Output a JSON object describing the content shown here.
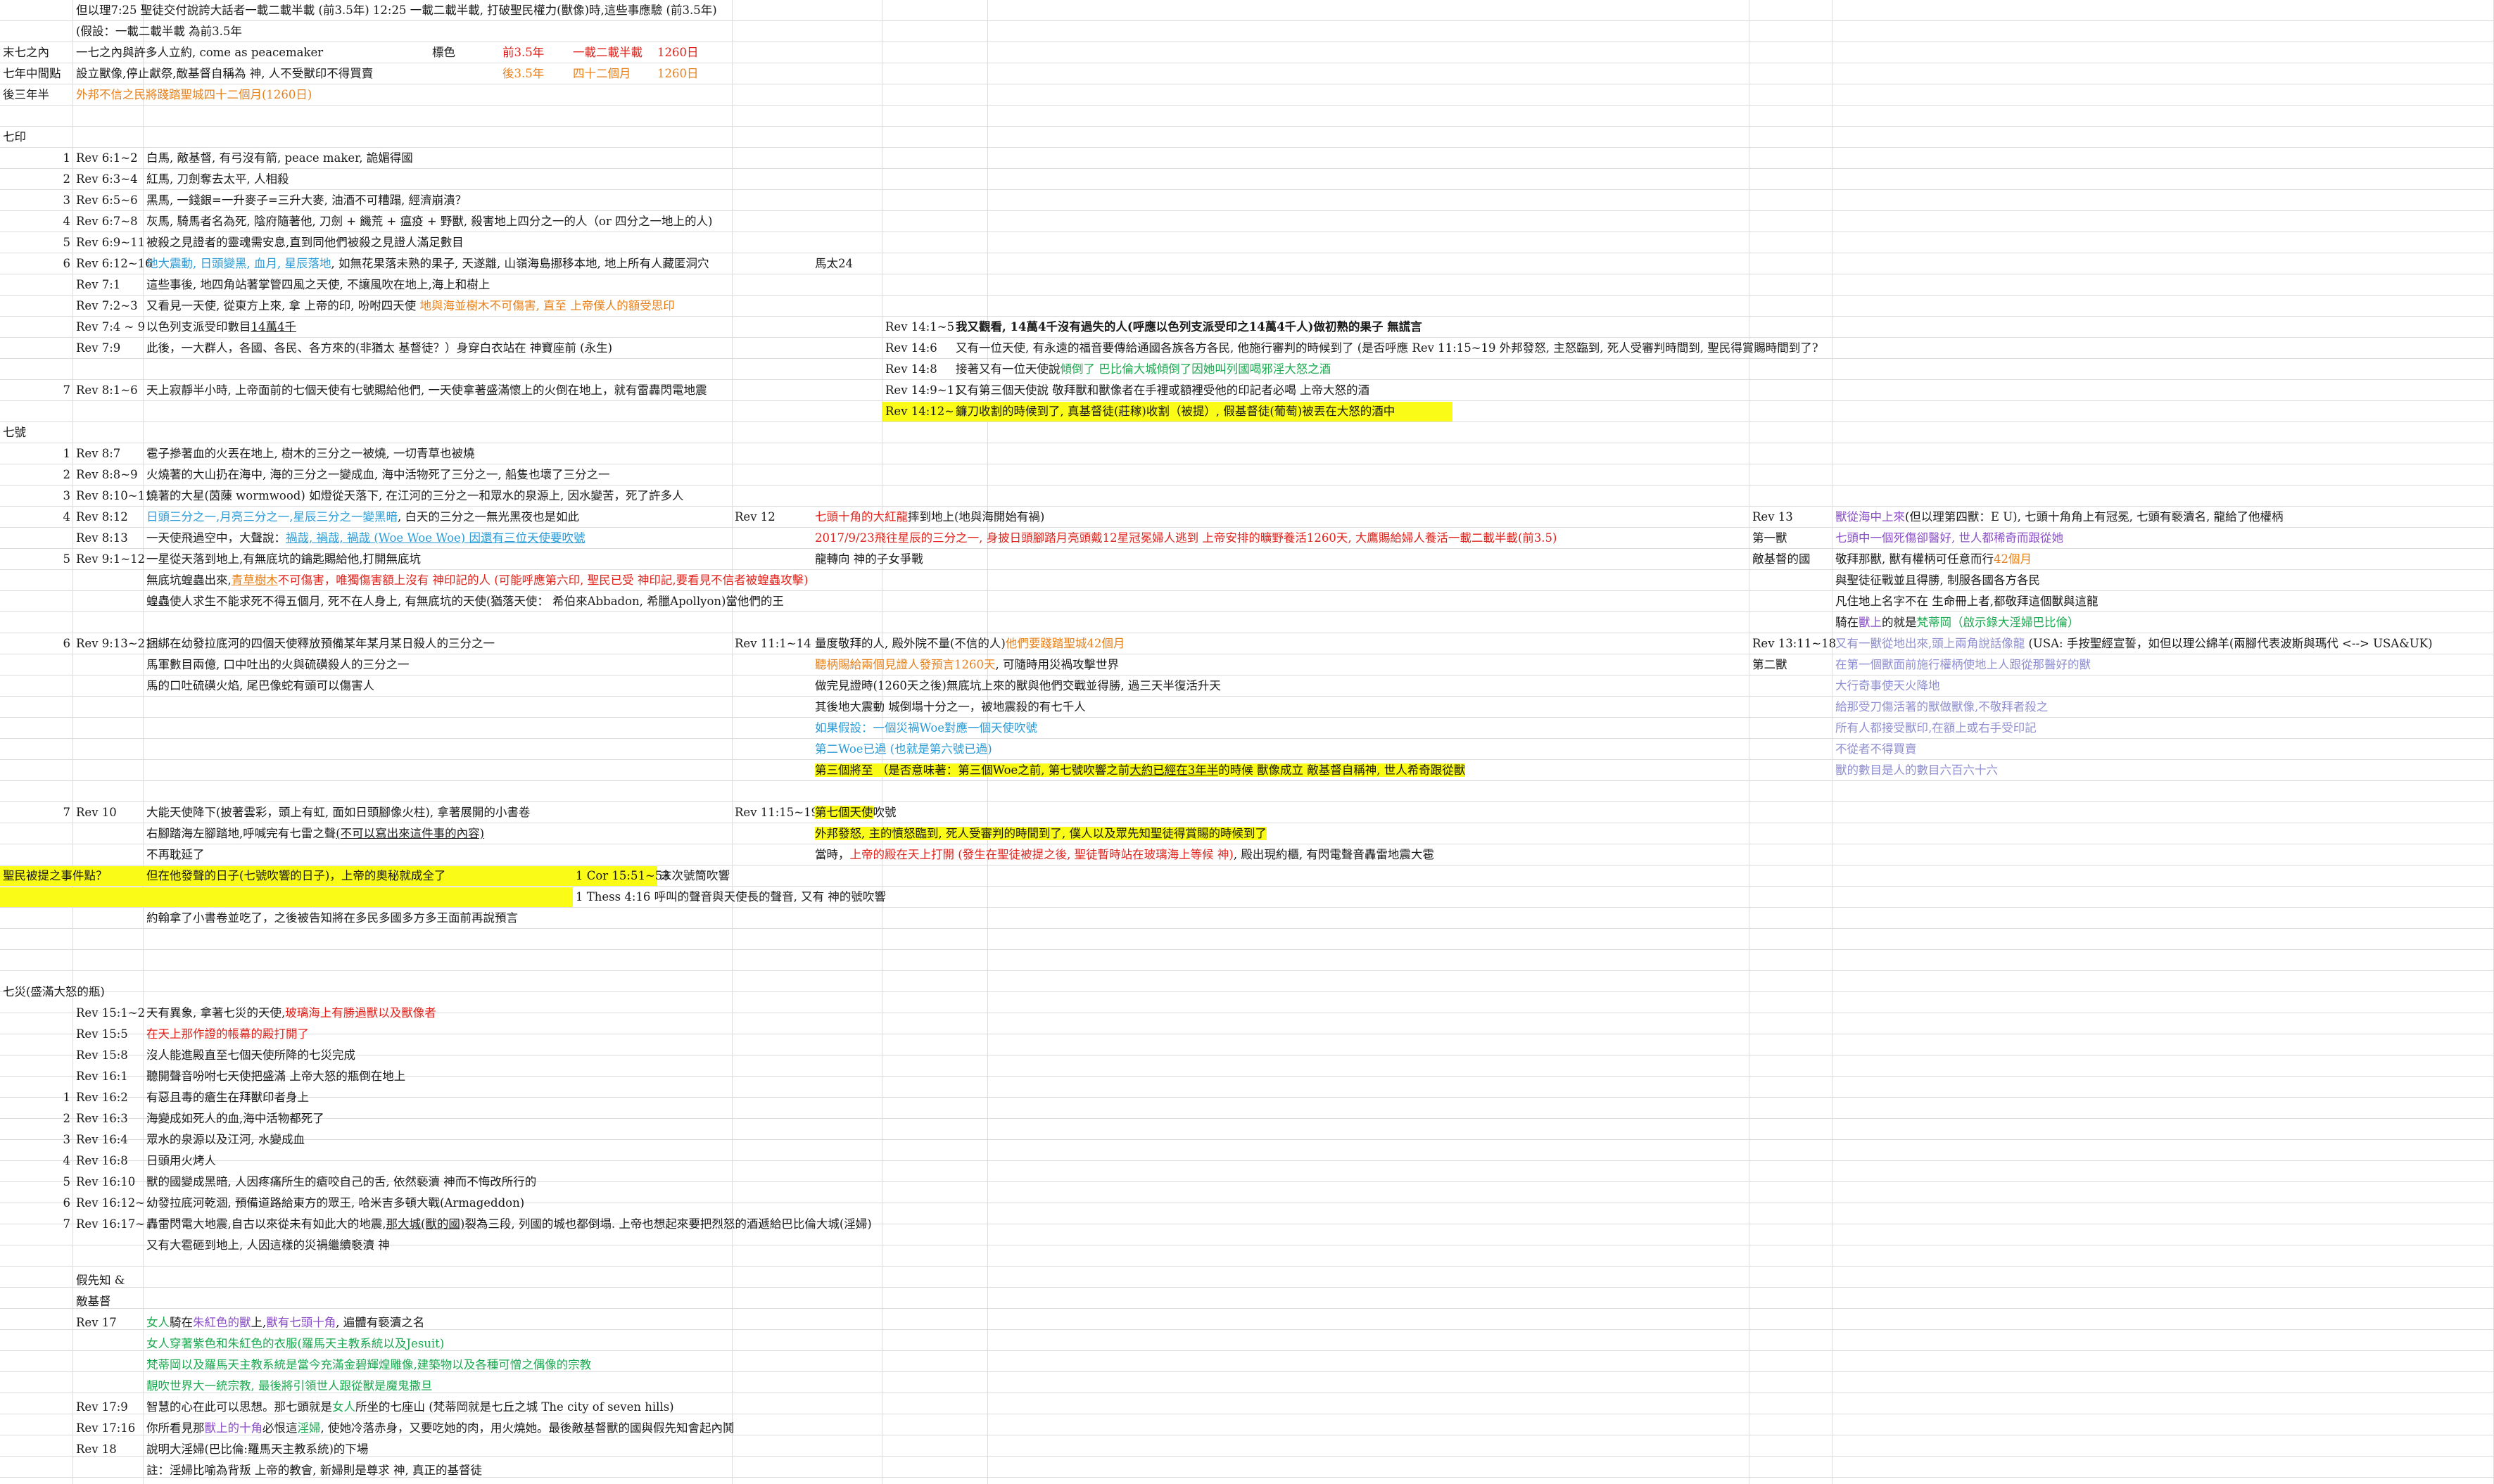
{
  "header": {
    "r0": "但以理7:25 聖徒交付說誇大話者一載二載半載 (前3.5年) 12:25 一載二載半載, 打破聖民權力(獸像)時,這些事應驗 (前3.5年)",
    "r1": "(假設：一載二載半載 為前3.5年",
    "r2a": "末七之內",
    "r2b": "一七之內與許多人立約, come as peacemaker",
    "r2c": "標色",
    "r2d": "前3.5年",
    "r2e": "一載二載半載",
    "r2f": "1260日",
    "r3a": "七年中間點",
    "r3b": "設立獸像,停止獻祭,敵基督自稱為 神, 人不受獸印不得買賣",
    "r3c": "後3.5年",
    "r3d": "四十二個月",
    "r3e": "1260日",
    "r4a": "後三年半",
    "r4b": "外邦不信之民將踐踏聖城四十二個月(1260日)"
  },
  "seals": {
    "title": "七印",
    "rows": [
      {
        "n": "1",
        "ref": "Rev 6:1~2",
        "text": "白馬, 敵基督, 有弓沒有箭, peace maker, 詭媚得國"
      },
      {
        "n": "2",
        "ref": "Rev 6:3~4",
        "text": "紅馬, 刀劍奪去太平, 人相殺"
      },
      {
        "n": "3",
        "ref": "Rev 6:5~6",
        "text": "黑馬, 一錢銀=一升麥子=三升大麥, 油酒不可糟蹋, 經濟崩潰？"
      },
      {
        "n": "4",
        "ref": "Rev 6:7~8",
        "text": "灰馬, 騎馬者名為死, 陰府隨著他, 刀劍 + 饑荒 + 瘟疫 + 野獸, 殺害地上四分之一的人（or 四分之一地上的人)"
      },
      {
        "n": "5",
        "ref": "Rev 6:9~11",
        "text": "被殺之見證者的靈魂需安息,直到同他們被殺之見證人滿足數目"
      },
      {
        "n": "6",
        "ref": "Rev 6:12~16",
        "textBlue": "地大震動, 日頭變黑, 血月, 星辰落地",
        "text": ", 如無花果落未熟的果子, 天遂離, 山嶺海島挪移本地, 地上所有人藏匿洞穴",
        "side": "馬太24"
      },
      {
        "n": "",
        "ref": "Rev 7:1",
        "text": "這些事後, 地四角站著掌管四風之天使, 不讓風吹在地上,海上和樹上"
      },
      {
        "n": "",
        "ref": "Rev 7:2~3",
        "text": "又看見一天使, 從東方上來, 拿 上帝的印, 吩咐四天使 ",
        "textOrange": "地與海並樹木不可傷害, 直至 上帝僕人的額受思印"
      },
      {
        "n": "",
        "ref": "Rev 7:4 ~ 9",
        "text": "以色列支派受印數目",
        "textU": "14萬4千"
      },
      {
        "n": "",
        "ref": "Rev 7:9",
        "text": "此後，一大群人，各國、各民、各方來的(非猶太 基督徒？）身穿白衣站在 神寶座前 (永生)"
      },
      {
        "n": "7",
        "ref": "Rev 8:1~6",
        "text": "天上寂靜半小時, 上帝面前的七個天使有七號賜給他們, 一天使拿著盛滿懷上的火倒在地上，就有雷轟閃電地震"
      }
    ],
    "right": [
      {
        "ref": "Rev 14:1~5",
        "text": "我又觀看, 14萬4千沒有過失的人(呼應以色列支派受印之14萬4千人)做初熟的果子 無謊言"
      },
      {
        "ref": "Rev 14:6",
        "text": "又有一位天使, 有永遠的福音要傳給通國各族各方各民, 他施行審判的時候到了 (是否呼應 Rev 11:15~19 外邦發怒, 主怒臨到, 死人受審判時間到, 聖民得賞賜時間到了?"
      },
      {
        "ref": "Rev 14:8",
        "text": "接著又有一位天使說",
        "textGreen": "傾倒了 巴比倫大城傾倒了因她叫列國喝邪淫大怒之酒"
      },
      {
        "ref": "Rev 14:9~11",
        "text": "又有第三個天使說 敬拜獸和獸像者在手裡或額裡受他的印記者必喝 上帝大怒的酒"
      },
      {
        "ref": "Rev 14:12~1",
        "text": "鐮刀收割的時候到了, 真基督徒(莊稼)收割（被提）, 假基督徒(葡萄)被丟在大怒的酒中"
      }
    ]
  },
  "trumpets": {
    "title": "七號",
    "rows": [
      {
        "n": "1",
        "ref": "Rev 8:7",
        "text": "雹子摻著血的火丟在地上, 樹木的三分之一被燒, 一切青草也被燒"
      },
      {
        "n": "2",
        "ref": "Rev 8:8~9",
        "text": "火燒著的大山扔在海中, 海的三分之一變成血, 海中活物死了三分之一, 船隻也壞了三分之一"
      },
      {
        "n": "3",
        "ref": "Rev 8:10~11",
        "text": "燒著的大星(茵蔯 wormwood) 如燈從天落下, 在江河的三分之一和眾水的泉源上, 因水變苦，死了許多人"
      },
      {
        "n": "4",
        "ref": "Rev 8:12",
        "textBlue": "日頭三分之一,月亮三分之一,星辰三分之一變黑暗",
        "text": ", 白天的三分之一無光黑夜也是如此"
      },
      {
        "n": "",
        "ref": "Rev 8:13",
        "text": "一天使飛過空中，大聲說：",
        "textBlueU": "禍哉, 禍哉, 禍哉 (Woe Woe Woe) 因還有三位天使要吹號"
      },
      {
        "n": "5",
        "ref": "Rev 9:1~12",
        "text": "一星從天落到地上,有無底坑的鑰匙賜給他,打開無底坑"
      },
      {
        "n": "",
        "ref": "",
        "text": "無底坑蝗蟲出來,",
        "textOrangeU": "青草樹木",
        "textRed": "不可傷害，唯獨傷害額上沒有 神印記的人 (可能呼應第六印, 聖民已受 神印記,要看見不信者被蝗蟲攻擊)"
      },
      {
        "n": "",
        "ref": "",
        "text": "蝗蟲使人求生不能求死不得五個月, 死不在人身上, 有無底坑的天使(猶落天使： 希伯來Abbadon, 希臘Apollyon)當他們的王"
      },
      {
        "n": "6",
        "ref": "Rev 9:13~21",
        "text": "捆綁在幼發拉底河的四個天使釋放預備某年某月某日殺人的三分之一"
      },
      {
        "n": "",
        "ref": "",
        "text": "馬軍數目兩億, 口中吐出的火與硫磺殺人的三分之一"
      },
      {
        "n": "",
        "ref": "",
        "text": "馬的口吐硫磺火焰, 尾巴像蛇有頭可以傷害人"
      },
      {
        "n": "7",
        "ref": "Rev 10",
        "text": "大能天使降下(披著雲彩，頭上有虹, 面如日頭腳像火柱), 拿著展開的小書卷"
      },
      {
        "n": "",
        "ref": "",
        "text": "右腳踏海左腳踏地,呼喊完有七雷之聲",
        "textU": "(不可以寫出來這件事的內容)"
      },
      {
        "n": "",
        "ref": "",
        "text": "不再耽延了"
      }
    ],
    "mid": [
      {
        "ref": "Rev 12",
        "textRed": "七頭十角的大紅龍",
        "text": "摔到地上(地與海開始有禍)"
      },
      {
        "ref": "",
        "textRed": "2017/9/23飛往星辰的三分之一, 身披日頭腳踏月亮頭戴12星冠冕婦人逃到 上帝安排的曠野養活1260天, 大鷹賜給婦人養活一載二載半載(前3.5)"
      },
      {
        "ref": "",
        "text": "龍轉向 神的子女爭戰"
      },
      {
        "ref": "Rev 11:1~14",
        "text": "量度敬拜的人, 殿外院不量(不信的人)",
        "textOrange": "他們要踐踏聖城42個月"
      },
      {
        "ref": "",
        "textOrange": "聽柄賜給兩個見證人發預言1260天",
        "text": ", 可隨時用災禍攻擊世界"
      },
      {
        "ref": "",
        "text": "做完見證時(1260天之後)無底坑上來的獸與他們交戰並得勝, 過三天半復活升天"
      },
      {
        "ref": "",
        "text": "其後地大震動 城倒塌十分之一，被地震殺的有七千人"
      },
      {
        "ref": "",
        "textBlue": "如果假設：一個災禍Woe對應一個天使吹號"
      },
      {
        "ref": "",
        "textBlue": "第二Woe已過 (也就是第六號已過)"
      },
      {
        "ref": "",
        "textHl": "第三個將至 （是否意味著：第三個Woe之前, 第七號吹響之前",
        "textHlU": "大約已經在3年半",
        "textHl2": "的時候 獸像成立 敵基督自稱神, 世人希奇跟從獸"
      },
      {
        "ref": "Rev 11:15~19",
        "textHl": "第七個天使",
        "text": "吹號"
      },
      {
        "ref": "",
        "textHl": "外邦發怒, 主的憤怒臨到, 死人受審判的時間到了, 僕人以及眾先知聖徒得賞賜的時候到了"
      },
      {
        "ref": "",
        "text": "當時，",
        "textRed": "上帝的殿在天上打開 (發生在聖徒被提之後, 聖徒暫時站在玻璃海上等候 神)",
        "text2": ", 殿出現約櫃, 有閃電聲音轟雷地震大雹"
      }
    ],
    "right": [
      {
        "ref": "Rev 13",
        "textPurple": "獸從海中上來",
        "textPurple2": "(但以理第四獸：E U), 七頭十角",
        "text": "角上有冠冕, 七頭有褻瀆名, 龍給了他權柄"
      },
      {
        "ref": "第一獸",
        "textPurple": "七頭中一個死傷卻醫好, 世人都稀奇而跟從她"
      },
      {
        "ref": "敵基督的國",
        "text": "敬拜那獸, 獸有權柄可任意而行",
        "textOrange": "42個月"
      },
      {
        "ref": "",
        "text": "與聖徒征戰並且得勝, 制服各國各方各民"
      },
      {
        "ref": "",
        "text": "凡住地上名字不在 生命冊上者,都敬拜這個獸與這龍"
      },
      {
        "ref": "",
        "text": "騎在",
        "textPurple": "獸上",
        "text2": "的就是",
        "textGreen": "梵蒂岡（啟示錄大淫婦巴比倫）"
      },
      {
        "ref": "Rev 13:11~18",
        "textLav": "又有一獸從地出來,頭上兩角說話像龍",
        "text": " (USA: 手按聖經宣誓，如但以理公綿羊(兩腳代表波斯與瑪代 <--> USA&UK)"
      },
      {
        "ref": "第二獸",
        "textLav": "在第一個獸面前施行權柄使地上人跟從那醫好的獸"
      },
      {
        "ref": "",
        "textLav": "大行奇事使天火降地"
      },
      {
        "ref": "",
        "textLav": "給那受刀傷活著的獸做獸像,不敬拜者殺之"
      },
      {
        "ref": "",
        "textLav": "所有人都接受獸印,在額上或右手受印記"
      },
      {
        "ref": "",
        "textLav": "不從者不得買賣"
      },
      {
        "ref": "",
        "textLav": "獸的數目是人的數目六百六十六"
      }
    ],
    "rapture": {
      "label": "聖民被提之事件點？",
      "text": "但在他發聲的日子(七號吹響的日子)，上帝的奧秘就成全了",
      "cor": "1 Cor 15:51~53",
      "corText": "末次號筒吹響",
      "thes": "1 Thess 4:16 呼叫的聲音與天使長的聲音, 又有 神的號吹響"
    },
    "after": "約翰拿了小書卷並吃了，之後被告知將在多民多國多方多王面前再說預言"
  },
  "bowls": {
    "title": "七災(盛滿大怒的瓶)",
    "rows": [
      {
        "n": "",
        "ref": "Rev 15:1~2",
        "text": "天有異象, 拿著七災的天使,",
        "textRed": "玻璃海上有勝過獸以及獸像者"
      },
      {
        "n": "",
        "ref": "Rev 15:5",
        "textRed": "在天上那作證的帳幕的殿打開了"
      },
      {
        "n": "",
        "ref": "Rev 15:8",
        "text": "沒人能進殿直至七個天使所降的七災完成"
      },
      {
        "n": "",
        "ref": "Rev 16:1",
        "text": "聽開聲音吩咐七天使把盛滿 上帝大怒的瓶倒在地上"
      },
      {
        "n": "1",
        "ref": "Rev 16:2",
        "text": "有惡且毒的瘡生在拜獸印者身上"
      },
      {
        "n": "2",
        "ref": "Rev 16:3",
        "text": "海變成如死人的血,海中活物都死了"
      },
      {
        "n": "3",
        "ref": "Rev 16:4",
        "text": "眾水的泉源以及江河, 水變成血"
      },
      {
        "n": "4",
        "ref": "Rev 16:8",
        "text": "日頭用火烤人"
      },
      {
        "n": "5",
        "ref": "Rev 16:10",
        "text": "獸的國變成黑暗, 人因疼痛所生的瘡咬自己的舌, 依然褻瀆 神而不悔改所行的"
      },
      {
        "n": "6",
        "ref": "Rev 16:12~1",
        "text": "幼發拉底河乾涸, 預備道路給東方的眾王, 哈米吉多頓大戰(Armageddon)"
      },
      {
        "n": "7",
        "ref": "Rev 16:17~",
        "text": "轟雷閃電大地震,自古以來從未有如此大的地震,",
        "textU": "那大城(獸的國)",
        "text2": "裂為三段, 列國的城也都倒塌. 上帝也想起來要把烈怒的酒遞給巴比倫大城(淫婦)"
      },
      {
        "n": "",
        "ref": "",
        "text": "又有大雹砸到地上, 人因這樣的災禍繼續褻瀆 神"
      }
    ]
  },
  "prophet": {
    "title1": "假先知 &",
    "title2": "敵基督",
    "rows": [
      {
        "ref": "Rev 17",
        "textGreen": "女人",
        "text": "騎在",
        "textPurple": "朱紅色的獸",
        "text2": "上,",
        "textPurple2": "獸有七頭十角",
        "text3": ", 遍體有褻瀆之名"
      },
      {
        "ref": "",
        "textGreen": "女人穿著紫色和朱紅色的衣服(羅馬天主教系統以及Jesuit)"
      },
      {
        "ref": "",
        "textGreen": "梵蒂岡以及羅馬天主教系統是當今充滿金碧輝煌雕像,建築物以及各種可憎之偶像的宗教"
      },
      {
        "ref": "",
        "textGreen": "靚吹世界大一統宗教, 最後將引領世人跟從獸是魔鬼撒旦"
      },
      {
        "ref": "Rev 17:9",
        "text": "智慧的心在此可以思想。那七頭就是",
        "textGreen": "女人",
        "text2": "所坐的七座山 (梵蒂岡就是七丘之城 The city of seven hills)"
      },
      {
        "ref": "Rev 17:16",
        "text": "你所看見那",
        "textPurple": "獸上的十角",
        "text2": "必恨這",
        "textGreen": "淫婦",
        "text3": ", 使她冷落赤身，又要吃她的肉，用火燒她。最後敵基督獸的國與假先知會起內鬨"
      },
      {
        "ref": "Rev 18",
        "text": "說明大淫婦(巴比倫:羅馬天主教系統)的下場"
      },
      {
        "ref": "",
        "text": "註：淫婦比喻為背叛 上帝的教會, 新婦則是尊求 神, 真正的基督徒"
      }
    ]
  },
  "colors": {
    "red": "#e0221b",
    "orange": "#e8801a",
    "blue": "#2a9bd6",
    "purple": "#8a4fc6",
    "green": "#1aa94f",
    "highlight": "#fbfb18"
  }
}
